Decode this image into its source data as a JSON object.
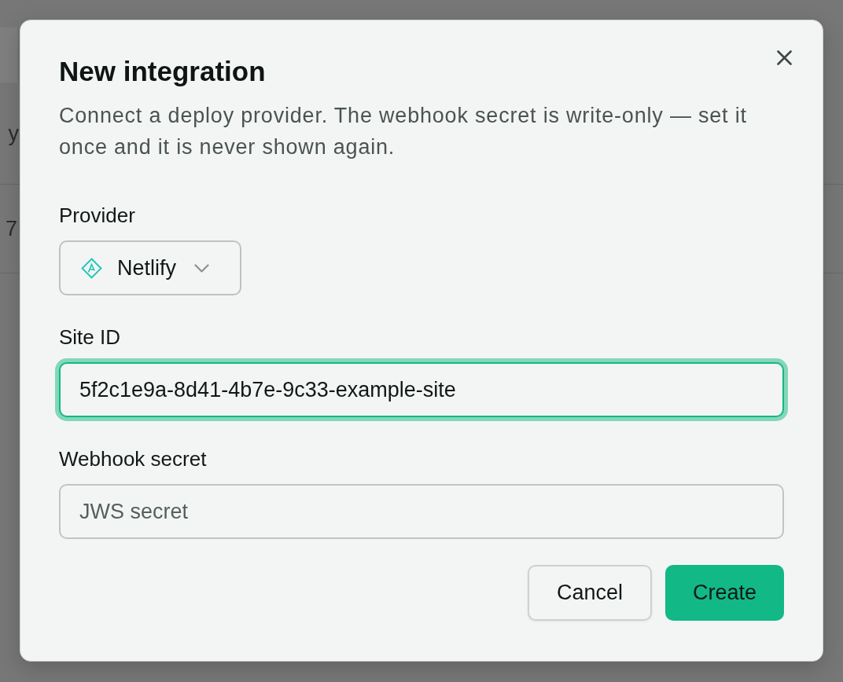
{
  "background_page": {
    "rows": [
      {
        "text": "y"
      },
      {
        "text": "7"
      }
    ]
  },
  "dialog": {
    "title": "New integration",
    "description": "Connect a deploy provider. The webhook secret is write-only — set it once and it is never shown again.",
    "fields": [
      {
        "kind": "select",
        "label": "Provider",
        "value": "Netlify"
      },
      {
        "kind": "text",
        "label": "Site ID",
        "value": "5f2c1e9a-8d41-4b7e-9c33-example-site",
        "focused": true
      },
      {
        "kind": "text",
        "label": "Webhook secret",
        "placeholder": "JWS secret",
        "focused": false
      }
    ],
    "buttons": [
      {
        "kind": "secondary",
        "label": "Cancel"
      },
      {
        "kind": "primary",
        "label": "Create"
      }
    ]
  }
}
